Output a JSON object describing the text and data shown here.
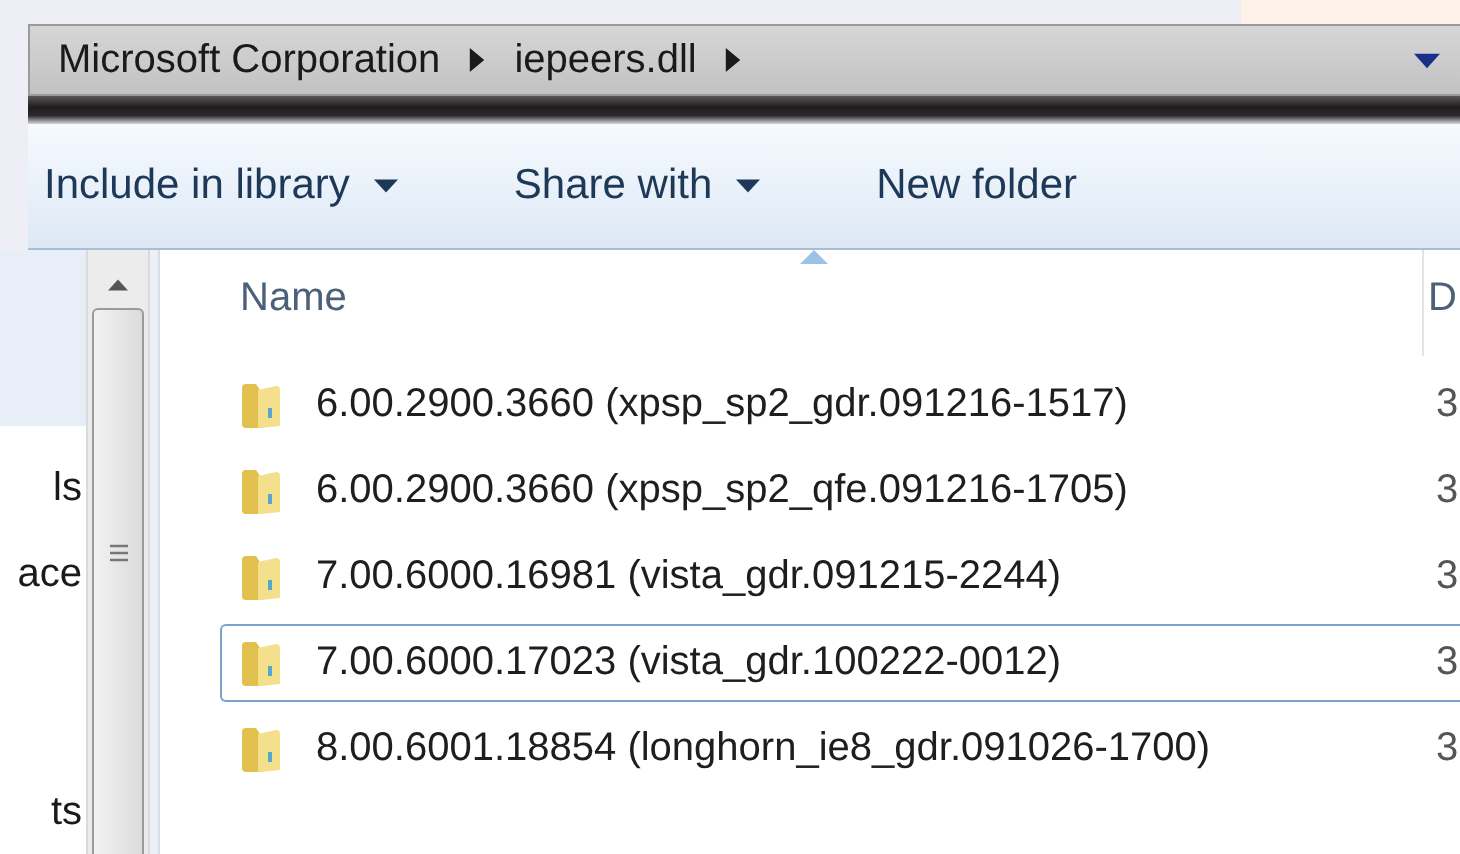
{
  "address_bar": {
    "crumbs": [
      "Microsoft Corporation",
      "iepeers.dll"
    ]
  },
  "toolbar": {
    "buttons": [
      {
        "label": "Include in library",
        "dropdown": true
      },
      {
        "label": "Share with",
        "dropdown": true
      },
      {
        "label": "New folder",
        "dropdown": false
      }
    ]
  },
  "nav_pane": {
    "items": [
      "ls",
      "ace",
      "ts"
    ]
  },
  "file_list": {
    "columns": [
      {
        "label": "Name",
        "sorted": true
      },
      {
        "label": "D",
        "sorted": false
      }
    ],
    "rows": [
      {
        "name": "6.00.2900.3660 (xpsp_sp2_gdr.091216-1517)",
        "column_2": "3",
        "focused": false
      },
      {
        "name": "6.00.2900.3660 (xpsp_sp2_qfe.091216-1705)",
        "column_2": "3",
        "focused": false
      },
      {
        "name": "7.00.6000.16981 (vista_gdr.091215-2244)",
        "column_2": "3",
        "focused": false
      },
      {
        "name": "7.00.6000.17023 (vista_gdr.100222-0012)",
        "column_2": "3",
        "focused": true
      },
      {
        "name": "8.00.6001.18854 (longhorn_ie8_gdr.091026-1700)",
        "column_2": "3",
        "focused": false
      }
    ]
  }
}
